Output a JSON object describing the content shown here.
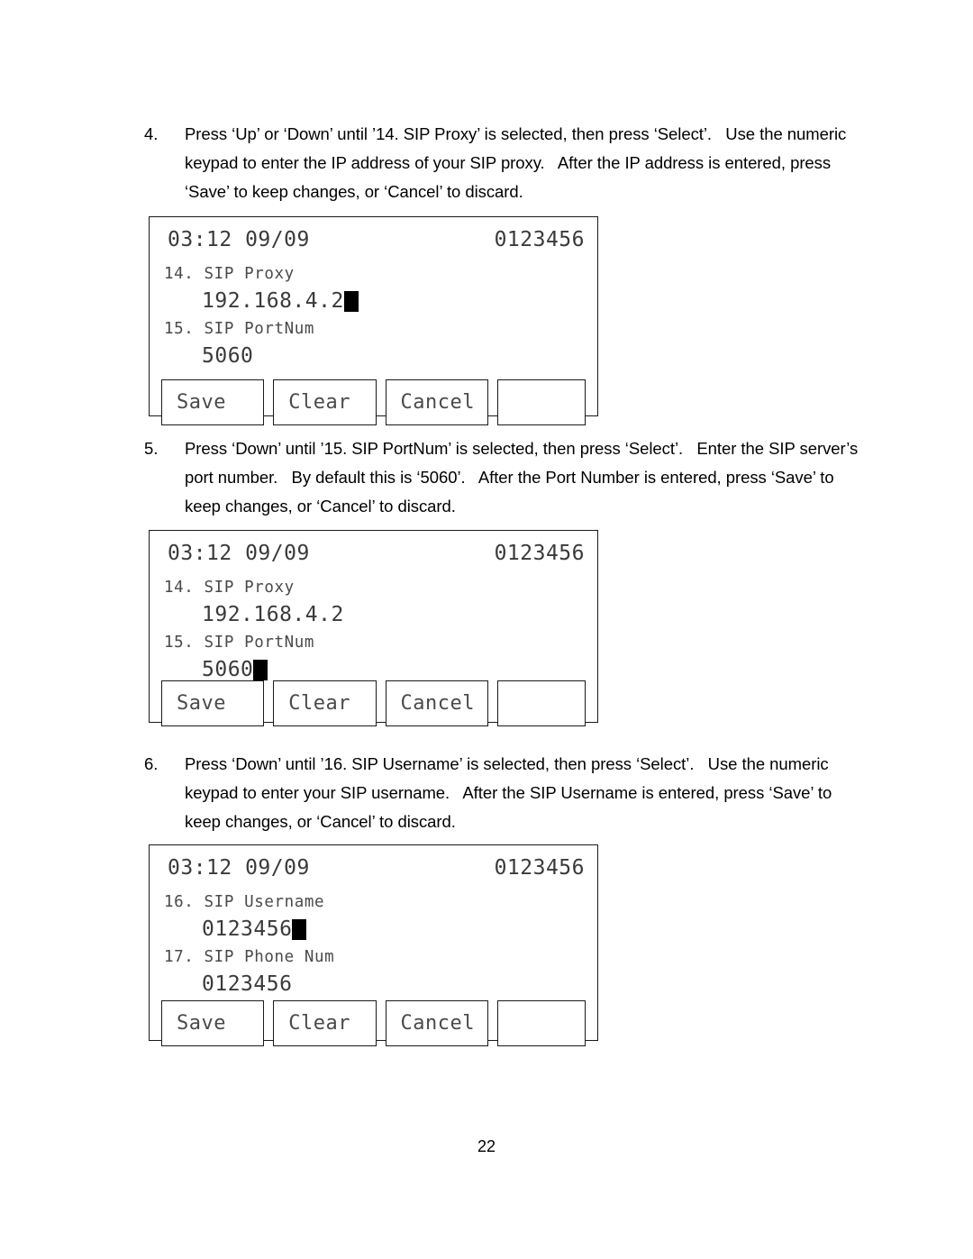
{
  "document": {
    "page_number": "22"
  },
  "steps": [
    {
      "number": "4.",
      "lines": [
        "Press ‘Up’ or ‘Down’ until ’14. SIP Proxy’ is selected, then press ‘Select’.   Use the numeric",
        "keypad to enter the IP address of your SIP proxy.   After the IP address is entered, press",
        "‘Save’ to keep changes, or ‘Cancel’ to discard."
      ]
    },
    {
      "number": "5.",
      "lines": [
        "Press ‘Down’ until ’15. SIP PortNum’ is selected, then press ‘Select’.   Enter the SIP server’s",
        "port number.   By default this is ‘5060’.   After the Port Number is entered, press ‘Save’ to",
        "keep changes, or ‘Cancel’ to discard."
      ]
    },
    {
      "number": "6.",
      "lines": [
        "Press ‘Down’ until ’16. SIP Username’ is selected, then press ‘Select’.   Use the numeric",
        "keypad to enter your SIP username.   After the SIP Username is entered, press ‘Save’ to",
        "keep changes, or ‘Cancel’ to discard."
      ]
    }
  ],
  "screens": [
    {
      "header": {
        "clock": "03:12 09/09",
        "extension": "0123456"
      },
      "rows": [
        {
          "label": "14. SIP Proxy",
          "value": "192.168.4.2",
          "cursor": true
        },
        {
          "label": "15. SIP PortNum",
          "value": "5060",
          "cursor": false
        }
      ],
      "softkeys": [
        {
          "label": "Save"
        },
        {
          "label": "Clear"
        },
        {
          "label": "Cancel"
        },
        {
          "label": ""
        }
      ]
    },
    {
      "header": {
        "clock": "03:12 09/09",
        "extension": "0123456"
      },
      "rows": [
        {
          "label": "14. SIP Proxy",
          "value": "192.168.4.2",
          "cursor": false
        },
        {
          "label": "15. SIP PortNum",
          "value": "5060",
          "cursor": true
        }
      ],
      "softkeys": [
        {
          "label": "Save"
        },
        {
          "label": "Clear"
        },
        {
          "label": "Cancel"
        },
        {
          "label": ""
        }
      ]
    },
    {
      "header": {
        "clock": "03:12 09/09",
        "extension": "0123456"
      },
      "rows": [
        {
          "label": "16. SIP Username",
          "value": "0123456",
          "cursor": true
        },
        {
          "label": "17. SIP Phone Num",
          "value": "0123456",
          "cursor": false
        }
      ],
      "softkeys": [
        {
          "label": "Save"
        },
        {
          "label": "Clear"
        },
        {
          "label": "Cancel"
        },
        {
          "label": ""
        }
      ]
    }
  ]
}
